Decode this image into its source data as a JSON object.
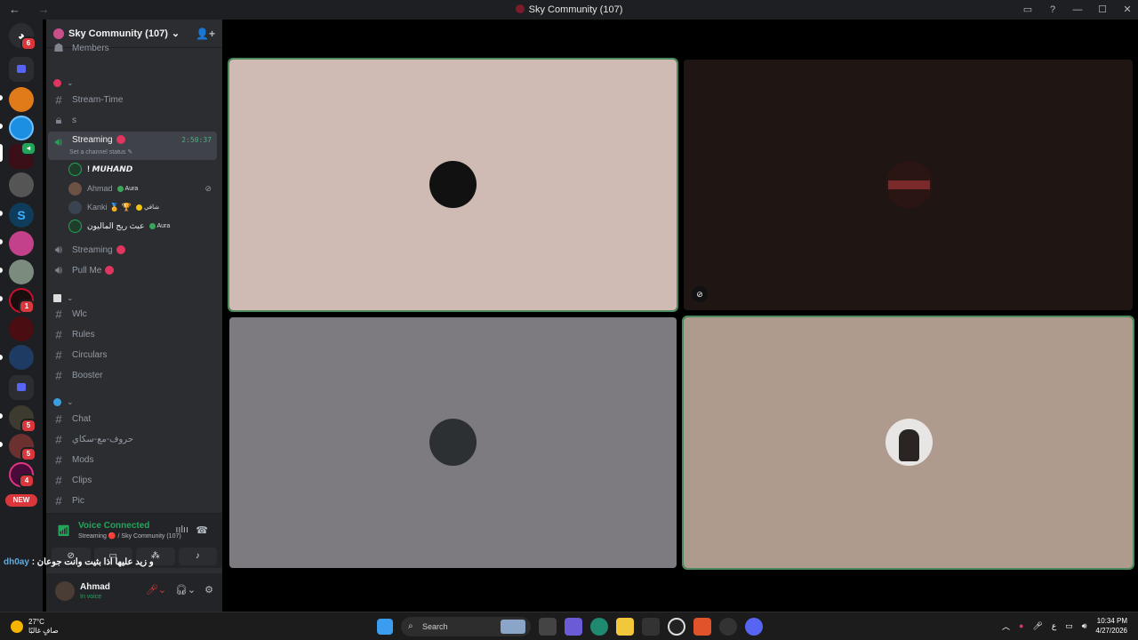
{
  "window": {
    "title": "Sky Community (107)",
    "nav_back": "←",
    "nav_forward": "→",
    "controls": [
      "▭",
      "?",
      "—",
      "☐",
      "✕"
    ]
  },
  "servers": {
    "badges": [
      "6",
      "1",
      "5",
      "5",
      "4",
      "46"
    ],
    "new_label": "NEW"
  },
  "guild": {
    "name": "Sky Community (107)",
    "chevron": "⌄",
    "members_label": "Members"
  },
  "channels": {
    "stream_time": "Stream-Time",
    "locked_s": "s",
    "streaming": "Streaming",
    "streaming_timer": "2:50:37",
    "streaming_status": "Set a channel status ✎",
    "streaming2": "Streaming",
    "pull_me": "Pull Me",
    "wlc": "Wlc",
    "rules": "Rules",
    "circulars": "Circulars",
    "booster": "Booster",
    "chat": "Chat",
    "arabic_channel": "حروف-مع-سكاي",
    "mods": "Mods",
    "clips": "Clips",
    "pic": "Pic"
  },
  "voice_users": [
    {
      "name": "! 𝙈𝙐𝙃𝘼𝙉𝘿",
      "tag": ""
    },
    {
      "name": "Ahmad",
      "tag": "Aura"
    },
    {
      "name": "Kanki 🏅 🏆",
      "tag": "شافي"
    },
    {
      "name": "عبث ريح الماليون",
      "tag": "Aura"
    }
  ],
  "voice_connection": {
    "title": "Voice Connected",
    "subtitle": "Streaming 🔴 / Sky Community (107)"
  },
  "overlay_message": {
    "author": "dh0ay",
    "text": "و زيد عليها اذا بثيت وانت جوعان :"
  },
  "user_panel": {
    "name": "Ahmad",
    "status": "In voice"
  },
  "taskbar": {
    "temperature": "27°C",
    "weather_desc": "صافٍ غالبًا",
    "search_placeholder": "Search",
    "lang": "ع",
    "time": "10:34 PM",
    "date": "4/27/2026"
  },
  "colors": {
    "tile1": "#cfbab4",
    "tile2": "#1f1512",
    "tile3": "#7d7b80",
    "tile4": "#ae9b8e",
    "accent_green": "#23a55a",
    "discord_blurple": "#5865f2"
  }
}
